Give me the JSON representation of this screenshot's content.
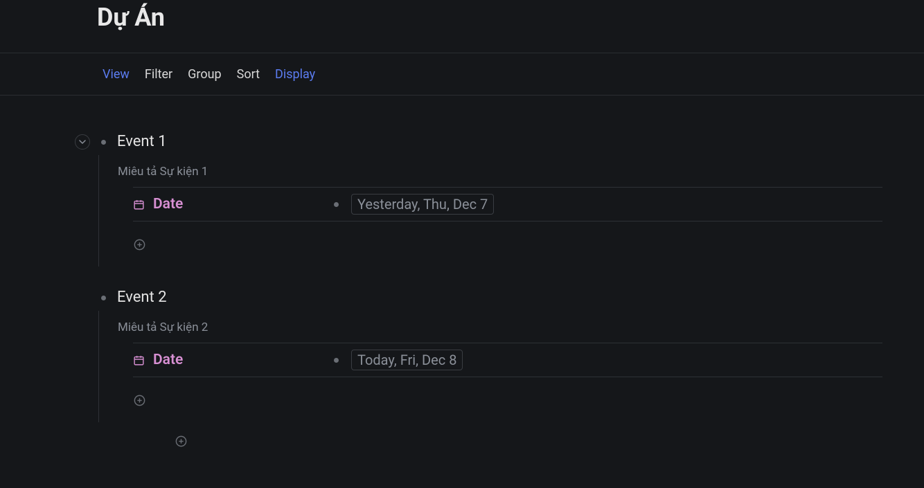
{
  "page": {
    "title": "Dự Án"
  },
  "toolbar": {
    "view": "View",
    "filter": "Filter",
    "group": "Group",
    "sort": "Sort",
    "display": "Display"
  },
  "events": [
    {
      "title": "Event 1",
      "description": "Miêu tả Sự kiện 1",
      "prop_label": "Date",
      "prop_value": "Yesterday, Thu, Dec 7"
    },
    {
      "title": "Event 2",
      "description": "Miêu tả Sự kiện 2",
      "prop_label": "Date",
      "prop_value": "Today, Fri, Dec 8"
    }
  ]
}
